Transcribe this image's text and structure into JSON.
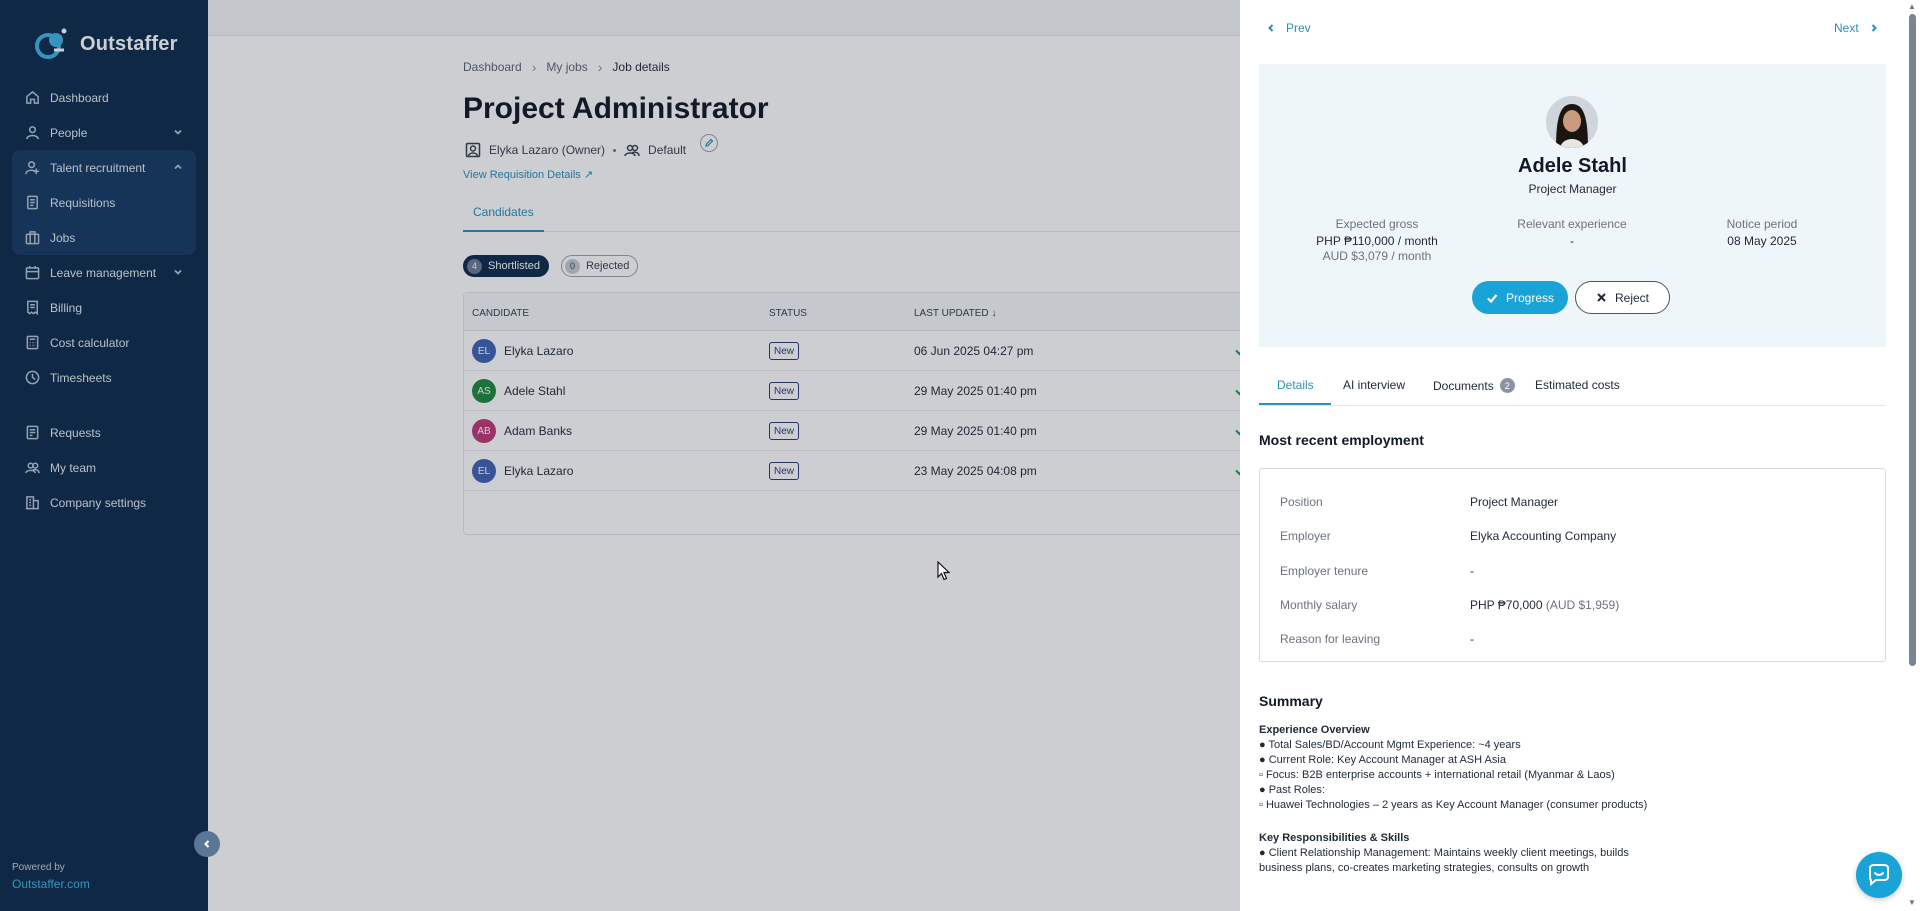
{
  "brand": {
    "name": "Outstaffer",
    "accent": "#1aa3d6",
    "sidebar_bg": "#0d2b4e"
  },
  "sidebar": {
    "items": [
      {
        "label": "Dashboard",
        "icon": "home-icon"
      },
      {
        "label": "People",
        "icon": "person-icon",
        "expandable": true
      },
      {
        "label": "Talent recruitment",
        "icon": "recruit-icon",
        "expanded": true
      },
      {
        "label": "Requisitions",
        "icon": "document-icon"
      },
      {
        "label": "Jobs",
        "icon": "briefcase-icon"
      },
      {
        "label": "Leave management",
        "icon": "calendar-icon",
        "expandable": true
      },
      {
        "label": "Billing",
        "icon": "receipt-icon"
      },
      {
        "label": "Cost calculator",
        "icon": "calculator-icon"
      },
      {
        "label": "Timesheets",
        "icon": "clock-icon"
      },
      {
        "label": "Requests",
        "icon": "request-icon"
      },
      {
        "label": "My team",
        "icon": "team-icon"
      },
      {
        "label": "Company settings",
        "icon": "building-icon"
      }
    ],
    "powered_by": "Powered by",
    "powered_link": "Outstaffer.com"
  },
  "main": {
    "breadcrumb": [
      "Dashboard",
      "My jobs",
      "Job details"
    ],
    "title": "Project Administrator",
    "owner": "Elyka Lazaro (Owner)",
    "team": "Default",
    "view_requisition": "View Requisition Details ↗",
    "tab": "Candidates",
    "pills": [
      {
        "count": "4",
        "label": "Shortlisted",
        "active": true
      },
      {
        "count": "0",
        "label": "Rejected",
        "active": false
      }
    ],
    "columns": [
      "CANDIDATE",
      "STATUS",
      "LAST UPDATED"
    ],
    "rows": [
      {
        "initials": "EL",
        "name": "Elyka Lazaro",
        "status": "New",
        "updated": "06 Jun 2025 04:27 pm",
        "color": "#3f63b5"
      },
      {
        "initials": "AS",
        "name": "Adele Stahl",
        "status": "New",
        "updated": "29 May 2025 01:40 pm",
        "color": "#1e8a3e"
      },
      {
        "initials": "AB",
        "name": "Adam Banks",
        "status": "New",
        "updated": "29 May 2025 01:40 pm",
        "color": "#c0397a"
      },
      {
        "initials": "EL",
        "name": "Elyka Lazaro",
        "status": "New",
        "updated": "23 May 2025 04:08 pm",
        "color": "#3f63b5"
      }
    ]
  },
  "drawer": {
    "prev": "Prev",
    "next": "Next",
    "name": "Adele Stahl",
    "role": "Project Manager",
    "stats": {
      "expected_gross_label": "Expected gross",
      "expected_gross_php": "PHP ₱110,000 / month",
      "expected_gross_aud": "AUD $3,079 / month",
      "relevant_experience_label": "Relevant experience",
      "relevant_experience": "-",
      "notice_period_label": "Notice period",
      "notice_period": "08 May 2025"
    },
    "progress": "Progress",
    "reject": "Reject",
    "tabs": [
      "Details",
      "AI interview",
      "Documents",
      "Estimated costs"
    ],
    "documents_count": "2",
    "employment_title": "Most recent employment",
    "employment": [
      {
        "k": "Position",
        "v": "Project Manager"
      },
      {
        "k": "Employer",
        "v": "Elyka Accounting Company"
      },
      {
        "k": "Employer tenure",
        "v": "-"
      },
      {
        "k": "Monthly salary",
        "v": "PHP ₱70,000",
        "extra": "(AUD $1,959)"
      },
      {
        "k": "Reason for leaving",
        "v": "-"
      }
    ],
    "summary_title": "Summary",
    "summary": {
      "h1": "Experience Overview",
      "lines1": [
        "● Total Sales/BD/Account Mgmt Experience: ~4 years",
        "● Current Role: Key Account Manager at ASH Asia",
        "▫ Focus: B2B enterprise accounts + international retail (Myanmar & Laos)",
        "● Past Roles:",
        "▫ Huawei Technologies – 2 years as Key Account Manager (consumer products)"
      ],
      "h2": "Key Responsibilities & Skills",
      "lines2": [
        "● Client Relationship Management: Maintains weekly client meetings, builds business plans, co-creates marketing strategies, consults on growth"
      ]
    }
  }
}
